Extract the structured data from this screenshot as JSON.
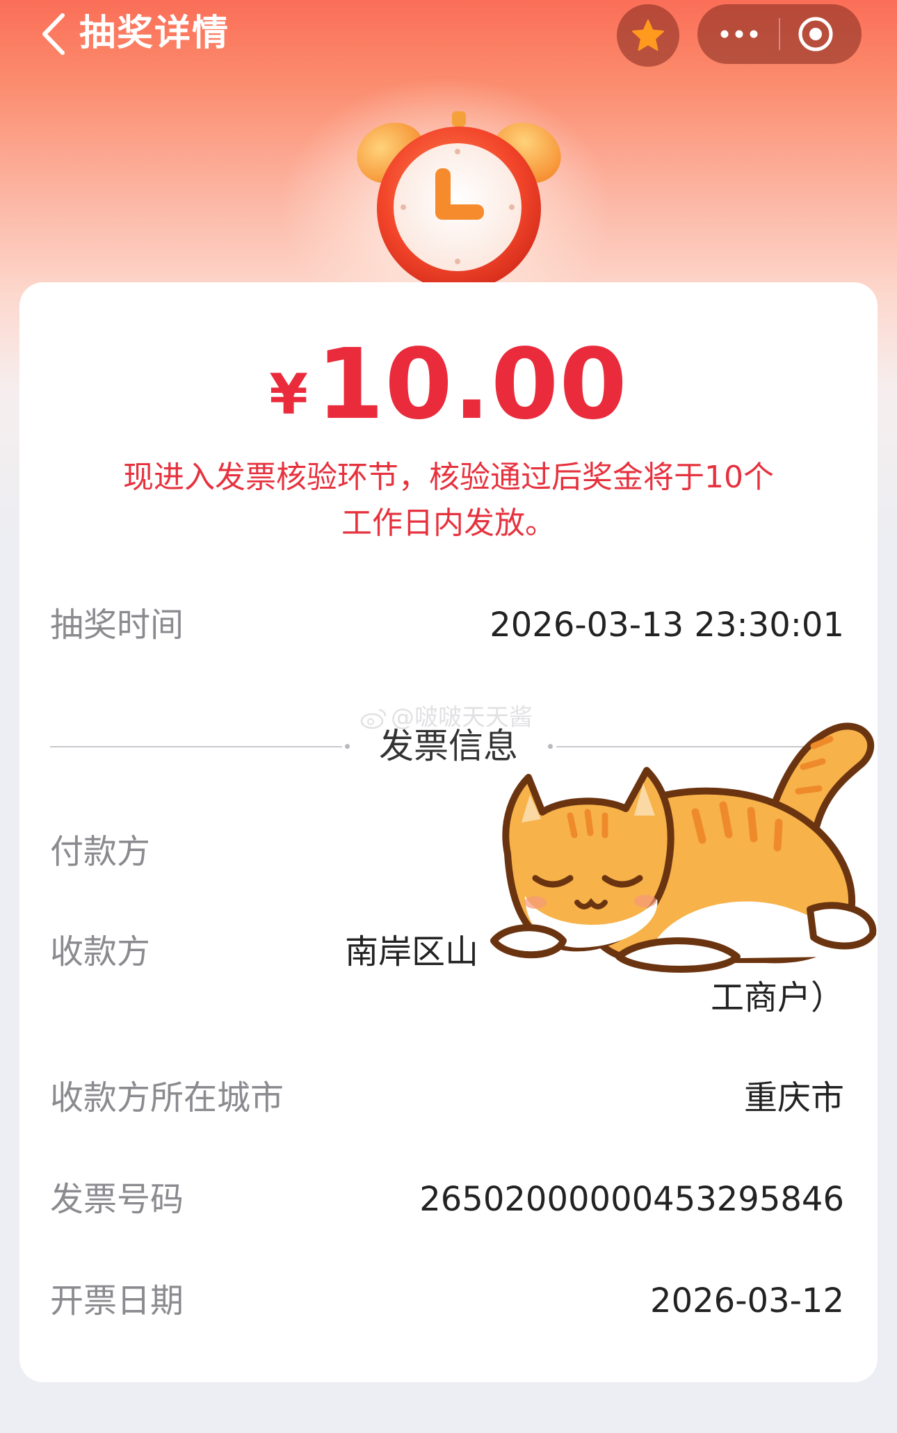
{
  "header": {
    "title": "抽奖详情",
    "back_icon": "chevron-left-icon",
    "favorite_icon": "star-icon",
    "more_icon": "more-dots-icon",
    "close_icon": "target-circle-icon"
  },
  "prize": {
    "currency": "¥",
    "amount": "10.00",
    "notice": "现进入发票核验环节，核验通过后奖金将于10个工作日内发放。"
  },
  "draw": {
    "time_label": "抽奖时间",
    "time_value": "2026-03-13 23:30:01"
  },
  "invoice": {
    "section_title": "发票信息",
    "watermark": "@啵啵天天酱",
    "payer_label": "付款方",
    "payer_value_visible": "）",
    "payee_label": "收款方",
    "payee_value_line1": "南岸区山",
    "payee_value_line2": "工商户）",
    "city_label": "收款方所在城市",
    "city_value": "重庆市",
    "number_label": "发票号码",
    "number_value": "26502000000453295846",
    "date_label": "开票日期",
    "date_value": "2026-03-12"
  },
  "colors": {
    "accent_red": "#ea2b3c",
    "header_orange": "#fb6e58"
  }
}
